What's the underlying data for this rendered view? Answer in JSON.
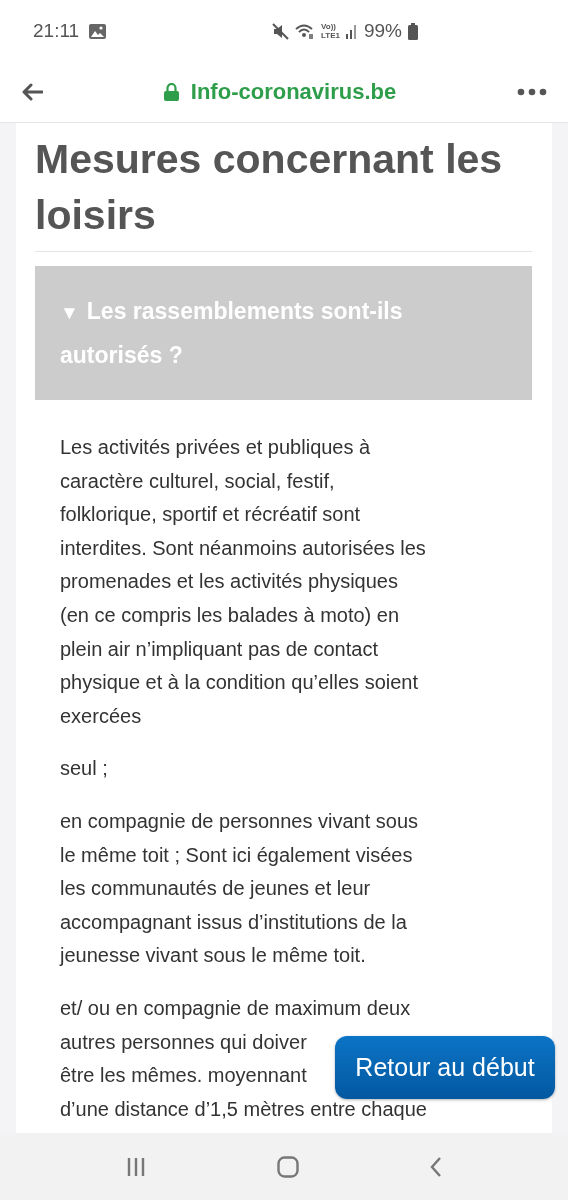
{
  "status_bar": {
    "time": "21:11",
    "volte_label": "Vo))",
    "lte_label": "LTE1",
    "battery": "99%"
  },
  "toolbar": {
    "site": "Info-coronavirus.be"
  },
  "page": {
    "heading": "Mesures concernant les loisirs",
    "accordion": {
      "marker": "▼",
      "title": "Les rassemblements sont-ils autorisés ?",
      "expanded": true
    },
    "paragraphs": [
      {
        "kind": "text",
        "text": "Les activités privées et publiques à\ncaractère culturel, social, festif,\nfolklorique, sportif et récréatif sont\ninterdites. Sont néanmoins autorisées les\npromenades et les activités physiques\n(en ce compris les balades à moto) en\nplein air n’impliquant pas de contact\nphysique et à la condition qu’elles soient\nexercées"
      },
      {
        "kind": "text",
        "text": "seul ;"
      },
      {
        "kind": "text",
        "text": "en compagnie de personnes vivant sous\nle même toit ; Sont ici également visées\nles communautés de jeunes et leur\naccompagnant issus d’institutions de la\njeunesse vivant sous le même toit."
      },
      {
        "kind": "covered",
        "lines": [
          "et/ ou en compagnie de maximum deux",
          "autres personnes qui doiver",
          "être les mêmes. moyennant",
          "d’une distance d’1,5 mètres entre chaque"
        ]
      }
    ]
  },
  "back_to_top": {
    "label": "Retour au début"
  }
}
